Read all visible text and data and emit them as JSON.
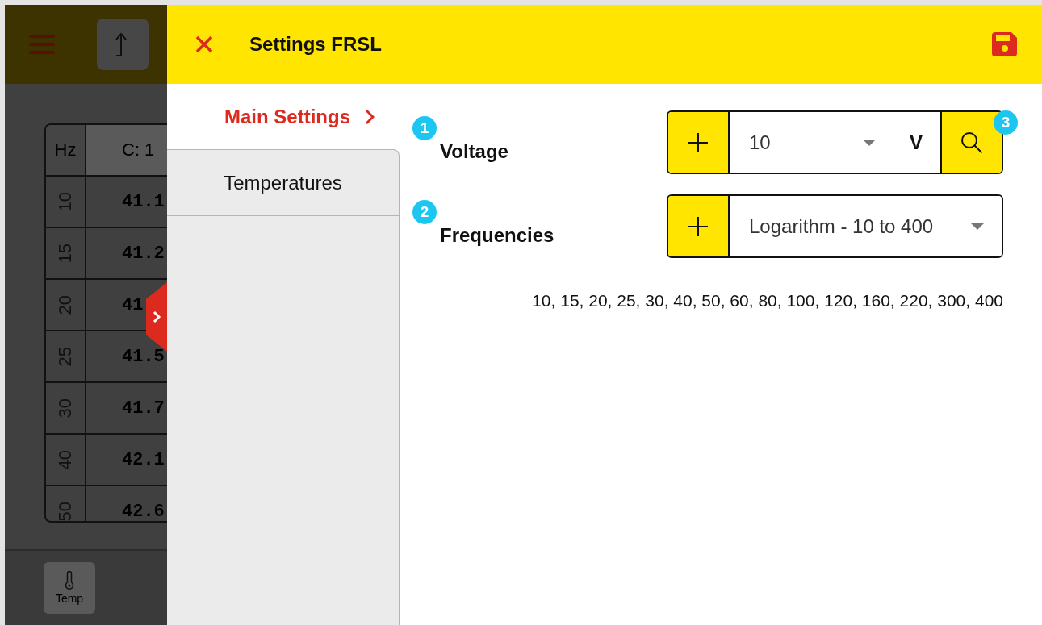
{
  "background_app": {
    "table": {
      "columns": [
        "Hz",
        "C: 1"
      ],
      "rows": [
        {
          "hz": "10",
          "value": "41.1"
        },
        {
          "hz": "15",
          "value": "41.2"
        },
        {
          "hz": "20",
          "value": "41"
        },
        {
          "hz": "25",
          "value": "41.5"
        },
        {
          "hz": "30",
          "value": "41.7"
        },
        {
          "hz": "40",
          "value": "42.1"
        },
        {
          "hz": "50",
          "value": "42.6"
        }
      ]
    },
    "footer": {
      "buttons": [
        {
          "label": "Temp"
        }
      ]
    }
  },
  "settings_panel": {
    "title": "Settings FRSL",
    "nav": [
      {
        "label": "Main Settings",
        "selected": true
      },
      {
        "label": "Temperatures",
        "selected": false
      }
    ],
    "rows": [
      {
        "kind": "select_with_unit",
        "badge": "1",
        "label": "Voltage",
        "value": "10",
        "unit": "V",
        "search_badge": "3"
      },
      {
        "kind": "select",
        "badge": "2",
        "label": "Frequencies",
        "value": "Logarithm - 10 to 400"
      }
    ],
    "frequency_list": "10, 15, 20, 25, 30, 40, 50, 60, 80, 100, 120, 160, 220, 300, 400"
  }
}
